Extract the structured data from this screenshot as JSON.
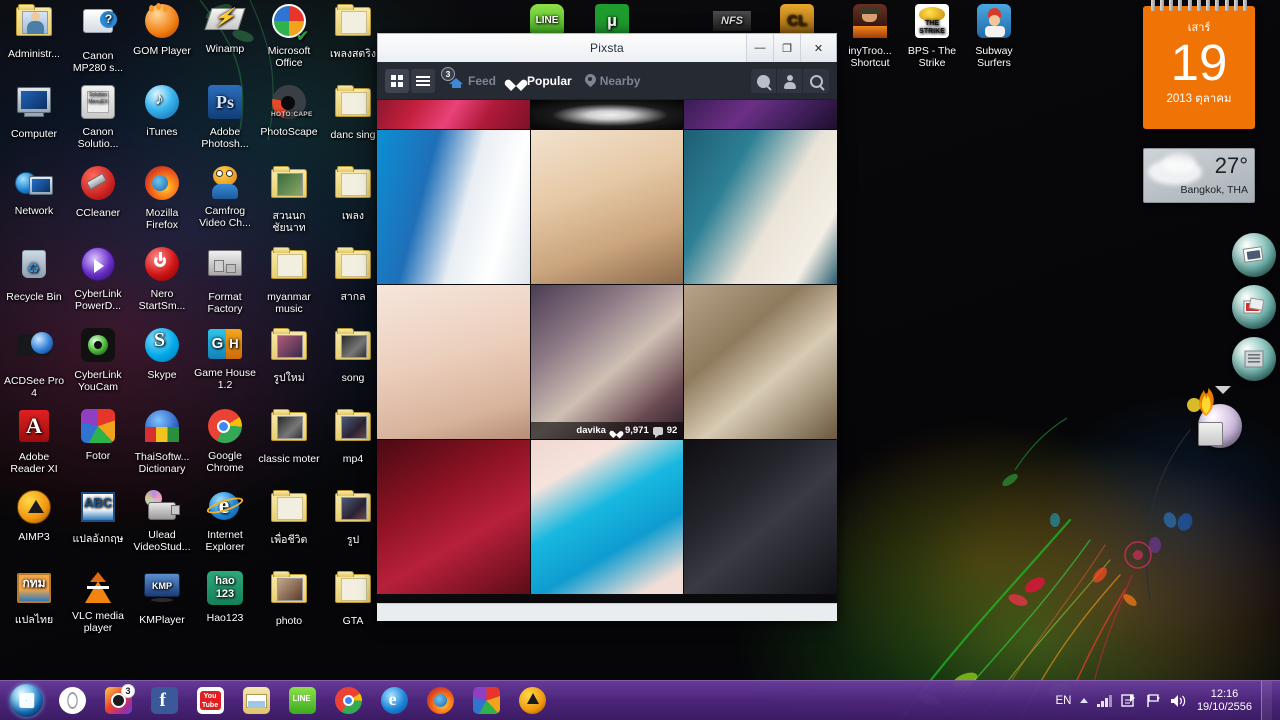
{
  "desktop": {
    "icons_col1": [
      {
        "label": "Administr...",
        "icon": "user-folder-icon"
      },
      {
        "label": "Computer",
        "icon": "computer-icon"
      },
      {
        "label": "Network",
        "icon": "network-icon"
      },
      {
        "label": "Recycle Bin",
        "icon": "recycle-bin-icon"
      },
      {
        "label": "ACDSee Pro 4",
        "icon": "acdsee-icon"
      },
      {
        "label": "Adobe Reader XI",
        "icon": "adobe-reader-icon"
      },
      {
        "label": "AIMP3",
        "icon": "aimp3-icon"
      },
      {
        "label": "แปลไทย",
        "icon": "thai-translate-icon"
      }
    ],
    "icons_col2": [
      {
        "label": "Canon MP280 s...",
        "icon": "canon-printer-icon"
      },
      {
        "label": "Canon Solutio...",
        "icon": "canon-solution-menu-icon"
      },
      {
        "label": "CCleaner",
        "icon": "ccleaner-icon"
      },
      {
        "label": "CyberLink PowerD...",
        "icon": "cyberlink-powerdvd-icon"
      },
      {
        "label": "CyberLink YouCam",
        "icon": "cyberlink-youcam-icon"
      },
      {
        "label": "Fotor",
        "icon": "fotor-icon"
      },
      {
        "label": "แปลอังกฤษ",
        "icon": "english-translate-icon"
      },
      {
        "label": "VLC media player",
        "icon": "vlc-icon"
      }
    ],
    "icons_col3": [
      {
        "label": "GOM Player",
        "icon": "gom-player-icon"
      },
      {
        "label": "iTunes",
        "icon": "itunes-icon"
      },
      {
        "label": "Mozilla Firefox",
        "icon": "firefox-icon"
      },
      {
        "label": "Nero StartSm...",
        "icon": "nero-icon"
      },
      {
        "label": "Skype",
        "icon": "skype-icon"
      },
      {
        "label": "ThaiSoftw... Dictionary",
        "icon": "thaisoftware-dictionary-icon"
      },
      {
        "label": "Ulead VideoStud...",
        "icon": "ulead-videostudio-icon"
      },
      {
        "label": "KMPlayer",
        "icon": "kmplayer-icon"
      }
    ],
    "icons_col4": [
      {
        "label": "Winamp",
        "icon": "winamp-icon"
      },
      {
        "label": "Adobe Photosh...",
        "icon": "photoshop-icon"
      },
      {
        "label": "Camfrog Video Ch...",
        "icon": "camfrog-icon"
      },
      {
        "label": "Format Factory",
        "icon": "format-factory-icon"
      },
      {
        "label": "Game House 1.2",
        "icon": "gamehouse-icon"
      },
      {
        "label": "Google Chrome",
        "icon": "chrome-icon"
      },
      {
        "label": "Internet Explorer",
        "icon": "internet-explorer-icon"
      },
      {
        "label": "Hao123",
        "icon": "hao123-icon"
      }
    ],
    "icons_col5": [
      {
        "label": "Microsoft Office",
        "icon": "microsoft-office-icon"
      },
      {
        "label": "PhotoScape",
        "icon": "photoscape-icon"
      },
      {
        "label": "สวนนกชัยนาท",
        "icon": "folder-icon"
      },
      {
        "label": "myanmar music",
        "icon": "folder-icon"
      },
      {
        "label": "รูปใหม่",
        "icon": "folder-icon"
      },
      {
        "label": "classic moter",
        "icon": "folder-icon"
      },
      {
        "label": "เพื่อชีวิต",
        "icon": "folder-icon"
      },
      {
        "label": "photo",
        "icon": "folder-icon"
      }
    ],
    "icons_col6": [
      {
        "label": "เพลงสตริง",
        "icon": "folder-icon"
      },
      {
        "label": "danc sing",
        "icon": "folder-icon"
      },
      {
        "label": "เพลง",
        "icon": "folder-icon"
      },
      {
        "label": "สากล",
        "icon": "folder-icon"
      },
      {
        "label": "song",
        "icon": "folder-icon"
      },
      {
        "label": "mp4",
        "icon": "folder-icon"
      },
      {
        "label": "รูป",
        "icon": "folder-icon"
      },
      {
        "label": "GTA",
        "icon": "folder-icon"
      }
    ],
    "icons_toprow": [
      {
        "label": "LINE",
        "icon": "line-app-icon"
      },
      {
        "label": "",
        "icon": "utorrent-icon"
      },
      {
        "label": "",
        "icon": "need-for-speed-icon"
      },
      {
        "label": "",
        "icon": "clash-icon"
      },
      {
        "label": "inyTroo... Shortcut",
        "icon": "tiny-troopers-icon"
      },
      {
        "label": "BPS - The Strike",
        "icon": "bps-the-strike-icon"
      },
      {
        "label": "Subway Surfers",
        "icon": "subway-surfers-icon"
      }
    ]
  },
  "calendar": {
    "day_of_week": "เสาร์",
    "day_number": "19",
    "month_year": "2013 ตุลาคม"
  },
  "weather": {
    "temperature": "27°",
    "location": "Bangkok, THA"
  },
  "pixsta": {
    "title": "Pixsta",
    "window_buttons": {
      "minimize": "—",
      "maximize": "❐",
      "close": "✕"
    },
    "view_modes": [
      {
        "name": "grid-view",
        "active": true
      },
      {
        "name": "list-view",
        "active": false
      }
    ],
    "nav": [
      {
        "label": "Feed",
        "icon": "home-icon",
        "active": false,
        "badge": "3"
      },
      {
        "label": "Popular",
        "icon": "heart-icon",
        "active": true,
        "badge": ""
      },
      {
        "label": "Nearby",
        "icon": "pin-icon",
        "active": false,
        "badge": ""
      }
    ],
    "actions": [
      {
        "name": "activity-button",
        "icon": "activity-icon"
      },
      {
        "name": "profile-button",
        "icon": "person-icon"
      },
      {
        "name": "search-button",
        "icon": "search-icon"
      }
    ],
    "photos": [
      {
        "alt": "red plaid clothing photo",
        "caption": null
      },
      {
        "alt": "white studded bracelet on black",
        "caption": null
      },
      {
        "alt": "purple toned figure",
        "caption": null
      },
      {
        "alt": "blue hair VIRGIN HAIR banner",
        "caption": null
      },
      {
        "alt": "bee tattoo on shoulder",
        "caption": null
      },
      {
        "alt": "mirror selfie in white dress",
        "caption": null
      },
      {
        "alt": "pale close-up",
        "caption": null
      },
      {
        "alt": "girl with dog in car",
        "caption": {
          "username": "davika",
          "likes": "9,971",
          "comments": "92"
        }
      },
      {
        "alt": "cat lying on floor",
        "caption": null
      },
      {
        "alt": "hand holding polaroid on red sheets",
        "caption": null
      },
      {
        "alt": "blue shorts Attack Attack print",
        "caption": null
      },
      {
        "alt": "dark concert stage",
        "caption": null
      }
    ]
  },
  "dock": {
    "items": [
      {
        "name": "photo-viewer-orb",
        "icon": "photos-icon"
      },
      {
        "name": "photo-album-orb",
        "icon": "album-icon"
      },
      {
        "name": "notes-orb",
        "icon": "notes-icon"
      },
      {
        "name": "extra-orb",
        "icon": "chip-icon"
      }
    ]
  },
  "taskbar": {
    "start_label": "Start",
    "pinned": [
      {
        "name": "opera-icon",
        "label": "Opera",
        "badge": ""
      },
      {
        "name": "instagram-icon",
        "label": "Instagram",
        "badge": "3"
      },
      {
        "name": "facebook-icon",
        "label": "Facebook",
        "badge": ""
      },
      {
        "name": "youtube-icon",
        "label": "YouTube",
        "badge": ""
      },
      {
        "name": "explorer-icon",
        "label": "Windows Explorer",
        "badge": ""
      },
      {
        "name": "line-icon",
        "label": "LINE",
        "badge": ""
      },
      {
        "name": "chrome-icon",
        "label": "Google Chrome",
        "badge": ""
      },
      {
        "name": "internet-explorer-icon",
        "label": "Internet Explorer",
        "badge": ""
      },
      {
        "name": "firefox-icon",
        "label": "Mozilla Firefox",
        "badge": ""
      },
      {
        "name": "fotor-icon",
        "label": "Fotor",
        "badge": ""
      },
      {
        "name": "aimp3-icon",
        "label": "AIMP3",
        "badge": ""
      }
    ],
    "tray": {
      "language": "EN",
      "time": "12:16",
      "date": "19/10/2556"
    }
  }
}
